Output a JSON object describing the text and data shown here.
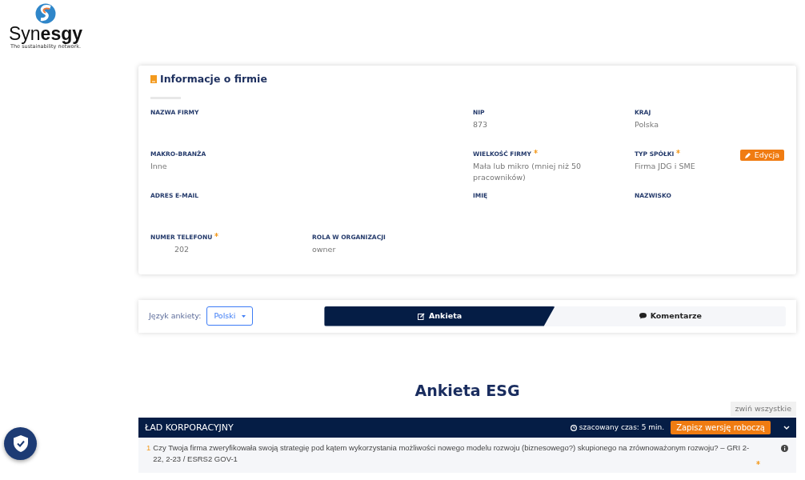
{
  "logo": {
    "name": "Syn",
    "name_bold": "esgy",
    "tagline": "The sustainability network."
  },
  "company_info": {
    "title": "Informacje o firmie",
    "edit_button": "Edycja",
    "fields": [
      {
        "label": "NAZWA FIRMY",
        "required": false
      },
      {
        "label": "NIP",
        "required": false,
        "value": "873"
      },
      {
        "label": "KRAJ",
        "required": false,
        "value": "Polska"
      },
      {
        "label": "MAKRO-BRANŻA",
        "required": false,
        "value": "Inne"
      },
      {
        "label": "WIELKOŚĆ FIRMY",
        "required": true,
        "value": "Mała lub mikro (mniej niż 50 pracowników)"
      },
      {
        "label": "TYP SPÓŁKI",
        "required": true,
        "value": "Firma JDG i SME"
      },
      {
        "label": "ADRES E-MAIL",
        "required": false
      },
      {
        "label": "IMIĘ",
        "required": false
      },
      {
        "label": "NAZWISKO",
        "required": false
      },
      {
        "label": "NUMER TELEFONU",
        "required": true,
        "value": "202"
      },
      {
        "label": "ROLA W ORGANIZACJI",
        "required": false,
        "value": "owner"
      }
    ]
  },
  "survey_bar": {
    "language_label": "Język ankiety:",
    "language": "Polski",
    "tabs": [
      {
        "label": "Ankieta",
        "selected": true,
        "kind": "edit"
      },
      {
        "label": "Komentarze",
        "selected": false,
        "kind": "comment"
      }
    ]
  },
  "survey": {
    "title": "Ankieta ESG",
    "collapse_all": "zwiń wszystkie",
    "section": {
      "title": "ŁAD KORPORACYJNY",
      "estimated_time": "szacowany czas: 5 min.",
      "save_draft": "Zapisz wersję roboczą",
      "expanded": true
    },
    "questions": [
      {
        "number": "1",
        "text": "Czy Twoja firma zweryfikowała swoją strategię pod kątem wykorzystania możliwości nowego modelu rozwoju (biznesowego?) skupionego na zrównoważonym rozwoju? – GRI 2-22, 2-23 / ESRS2 GOV-1",
        "required": true
      }
    ]
  }
}
